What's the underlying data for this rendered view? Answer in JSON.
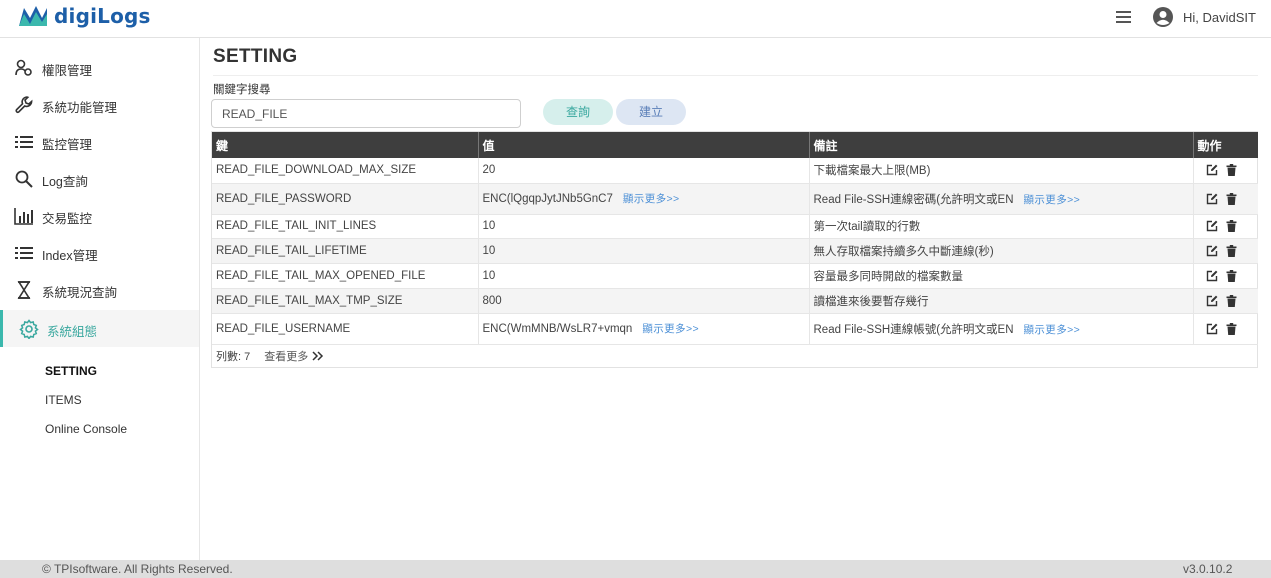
{
  "header": {
    "logo_part1": "digi",
    "logo_part2": "Logs",
    "user_greeting": "Hi, DavidSIT"
  },
  "sidebar": {
    "items": [
      {
        "label": "權限管理",
        "icon": "user-group-icon"
      },
      {
        "label": "系統功能管理",
        "icon": "wrench-icon"
      },
      {
        "label": "監控管理",
        "icon": "list-icon"
      },
      {
        "label": "Log查詢",
        "icon": "search-icon"
      },
      {
        "label": "交易監控",
        "icon": "bar-chart-icon"
      },
      {
        "label": "Index管理",
        "icon": "list-icon"
      },
      {
        "label": "系統現況查詢",
        "icon": "hourglass-icon"
      },
      {
        "label": "系統組態",
        "icon": "gear-icon"
      }
    ],
    "sub_items": [
      "SETTING",
      "ITEMS",
      "Online Console"
    ]
  },
  "main": {
    "title": "SETTING",
    "search_label": "關鍵字搜尋",
    "search_value": "READ_FILE",
    "query_button": "查詢",
    "create_button": "建立"
  },
  "table": {
    "headers": [
      "鍵",
      "值",
      "備註",
      "動作"
    ],
    "more_label": "顯示更多>>",
    "rows": [
      {
        "key": "READ_FILE_DOWNLOAD_MAX_SIZE",
        "value": "20",
        "note": "下載檔案最大上限(MB)"
      },
      {
        "key": "READ_FILE_PASSWORD",
        "value": "ENC(lQgqpJytJNb5GnC7",
        "note": "Read File-SSH連線密碼(允許明文或EN"
      },
      {
        "key": "READ_FILE_TAIL_INIT_LINES",
        "value": "10",
        "note": "第一次tail讀取的行數"
      },
      {
        "key": "READ_FILE_TAIL_LIFETIME",
        "value": "10",
        "note": "無人存取檔案持續多久中斷連線(秒)"
      },
      {
        "key": "READ_FILE_TAIL_MAX_OPENED_FILE",
        "value": "10",
        "note": "容量最多同時開啟的檔案數量"
      },
      {
        "key": "READ_FILE_TAIL_MAX_TMP_SIZE",
        "value": "800",
        "note": "讀檔進來後要暫存幾行"
      },
      {
        "key": "READ_FILE_USERNAME",
        "value": "ENC(WmMNB/WsLR7+vmqn",
        "note": "Read File-SSH連線帳號(允許明文或EN"
      }
    ],
    "row_count": "列數: 7",
    "view_more": "查看更多"
  },
  "footer": {
    "copyright": "© TPIsoftware. All Rights Reserved.",
    "version": "v3.0.10.2"
  }
}
